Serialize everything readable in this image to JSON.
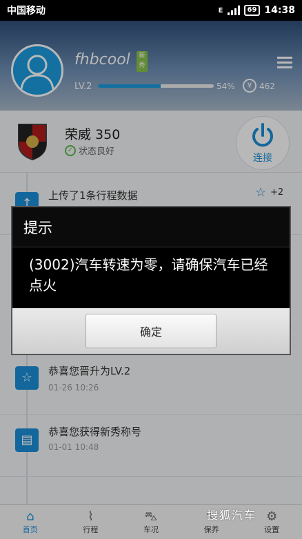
{
  "status_bar": {
    "carrier": "中国移动",
    "network": "E",
    "battery": "69",
    "time": "14:38"
  },
  "profile": {
    "username": "fhbcool",
    "badge": "新秀",
    "level": "LV.2",
    "progress_percent": 54,
    "progress_label": "54%",
    "coin_symbol": "¥",
    "coins": "462"
  },
  "car": {
    "name": "荣威 350",
    "status": "状态良好",
    "connect_label": "连接"
  },
  "feed": {
    "items": [
      {
        "title": "上传了1条行程数据",
        "time": "",
        "points": "+2"
      },
      {
        "title": "恭喜您晋升为LV.2",
        "time": "01-26 10:26",
        "points": ""
      },
      {
        "title": "恭喜您获得新秀称号",
        "time": "01-01 10:48",
        "points": ""
      }
    ]
  },
  "nav": {
    "tabs": [
      {
        "label": "首页",
        "icon": "home-icon"
      },
      {
        "label": "行程",
        "icon": "route-icon"
      },
      {
        "label": "车况",
        "icon": "car-icon"
      },
      {
        "label": "保养",
        "icon": "wrench-icon"
      },
      {
        "label": "设置",
        "icon": "settings-icon"
      }
    ]
  },
  "dialog": {
    "title": "提示",
    "message": "(3002)汽车转速为零，请确保汽车已经点火",
    "ok_label": "确定"
  },
  "watermark": "搜狐汽车"
}
